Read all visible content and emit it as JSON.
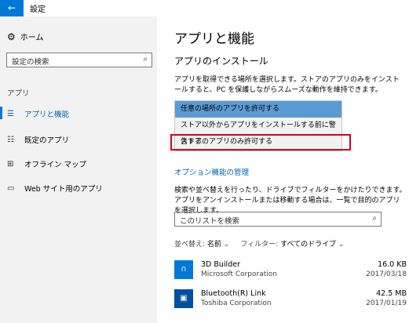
{
  "window": {
    "title": "設定",
    "back_icon": "arrow-left-icon"
  },
  "sidebar": {
    "home_label": "ホーム",
    "search_placeholder": "設定の検索",
    "section_label": "アプリ",
    "items": [
      {
        "label": "アプリと機能",
        "icon": "list-icon",
        "active": true
      },
      {
        "label": "既定のアプリ",
        "icon": "default-apps-icon",
        "active": false
      },
      {
        "label": "オフライン マップ",
        "icon": "map-icon",
        "active": false
      },
      {
        "label": "Web サイト用のアプリ",
        "icon": "website-apps-icon",
        "active": false
      }
    ]
  },
  "main": {
    "title": "アプリと機能",
    "install_heading": "アプリのインストール",
    "install_desc": "アプリを取得できる場所を選択します。ストアのアプリのみをインストールすると、PC を保護しながらスムーズな動作を維持できます。",
    "dropdown_options": [
      "任意の場所のアプリを許可する",
      "ストア以外からアプリをインストールする前に警告する",
      "ストアのアプリのみ許可する"
    ],
    "optional_features_link": "オプション機能の管理",
    "list_desc": "検索や並べ替えを行ったり、ドライブでフィルターをかけたりできます。アプリをアンインストールまたは移動する場合は、一覧で目的のアプリを選択します。",
    "list_search_placeholder": "このリストを検索",
    "sort_label": "並べ替え:",
    "sort_value": "名前",
    "filter_label": "フィルター:",
    "filter_value": "すべてのドライブ",
    "apps": [
      {
        "name": "3D Builder",
        "publisher": "Microsoft Corporation",
        "size": "16.0 KB",
        "date": "2017/03/18"
      },
      {
        "name": "Bluetooth(R) Link",
        "publisher": "Toshiba Corporation",
        "size": "42.5 MB",
        "date": "2017/01/19"
      }
    ]
  },
  "colors": {
    "accent": "#0078d7",
    "link": "#0063b1",
    "highlight_border": "#d0021b",
    "selected_option": "#5b9bd5"
  }
}
